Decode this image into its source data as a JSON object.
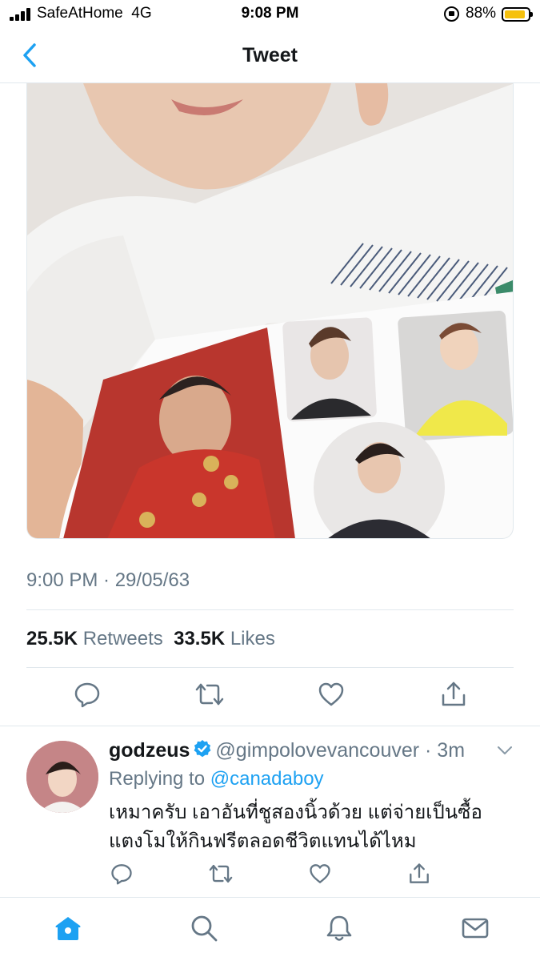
{
  "status_bar": {
    "carrier": "SafeAtHome",
    "network": "4G",
    "time": "9:08 PM",
    "battery": "88%",
    "battery_level": 0.88,
    "battery_color": "#f6c10e"
  },
  "nav": {
    "title": "Tweet",
    "back_icon": "chevron-left-icon"
  },
  "tweet": {
    "timestamp": "9:00 PM · 29/05/63",
    "retweets_count": "25.5K",
    "retweets_label": "Retweets",
    "likes_count": "33.5K",
    "likes_label": "Likes",
    "actions": [
      "reply-icon",
      "retweet-icon",
      "like-icon",
      "share-icon"
    ]
  },
  "reply": {
    "display_name": "godzeus",
    "handle_time": "@gimpolovevancouver · 3m",
    "replying_prefix": "Replying to",
    "replying_to": "@canadaboy",
    "text": "เหมาครับ เอาอันที่ชูสองนิ้วด้วย แต่จ่ายเป็นซื้อแตงโมให้กินฟรีตลอดชีวิตแทนได้ไหม",
    "actions": [
      "reply-icon",
      "retweet-icon",
      "like-icon",
      "share-icon"
    ]
  },
  "tab_bar": {
    "items": [
      "home-icon",
      "search-icon",
      "notifications-icon",
      "messages-icon"
    ],
    "active": "home-icon"
  },
  "colors": {
    "accent": "#1da1f2",
    "secondary_text": "#657786",
    "divider": "#e1e8ed",
    "icon_gray": "#657786"
  }
}
